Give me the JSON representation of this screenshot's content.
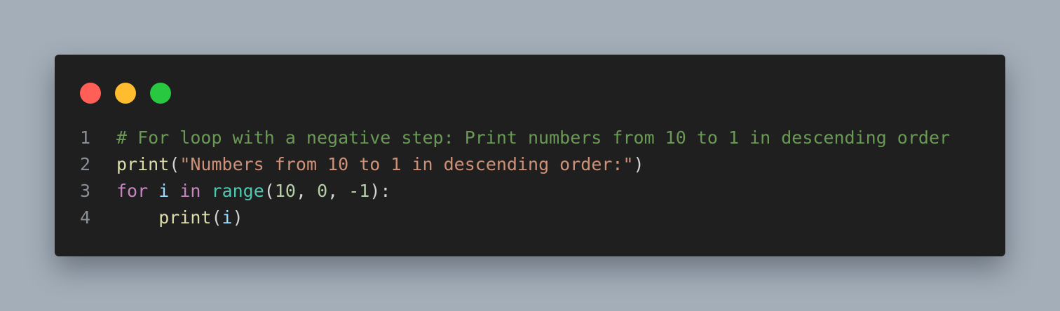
{
  "window": {
    "controls": {
      "close_color": "#ff5f57",
      "minimize_color": "#febc2e",
      "maximize_color": "#28c840"
    }
  },
  "code": {
    "lines": [
      {
        "number": "1",
        "tokens": [
          {
            "text": "# For loop with a negative step: Print numbers from 10 to 1 in descending order",
            "type": "comment"
          }
        ]
      },
      {
        "number": "2",
        "tokens": [
          {
            "text": "print",
            "type": "func"
          },
          {
            "text": "(",
            "type": "punc"
          },
          {
            "text": "\"Numbers from 10 to 1 in descending order:\"",
            "type": "string"
          },
          {
            "text": ")",
            "type": "punc"
          }
        ]
      },
      {
        "number": "3",
        "tokens": [
          {
            "text": "for",
            "type": "keyword"
          },
          {
            "text": " ",
            "type": "punc"
          },
          {
            "text": "i",
            "type": "var"
          },
          {
            "text": " ",
            "type": "punc"
          },
          {
            "text": "in",
            "type": "keyword"
          },
          {
            "text": " ",
            "type": "punc"
          },
          {
            "text": "range",
            "type": "builtin"
          },
          {
            "text": "(",
            "type": "punc"
          },
          {
            "text": "10",
            "type": "number"
          },
          {
            "text": ", ",
            "type": "punc"
          },
          {
            "text": "0",
            "type": "number"
          },
          {
            "text": ", ",
            "type": "punc"
          },
          {
            "text": "-1",
            "type": "number"
          },
          {
            "text": "):",
            "type": "punc"
          }
        ]
      },
      {
        "number": "4",
        "tokens": [
          {
            "text": "    ",
            "type": "punc"
          },
          {
            "text": "print",
            "type": "func"
          },
          {
            "text": "(",
            "type": "punc"
          },
          {
            "text": "i",
            "type": "var"
          },
          {
            "text": ")",
            "type": "punc"
          }
        ]
      }
    ]
  }
}
